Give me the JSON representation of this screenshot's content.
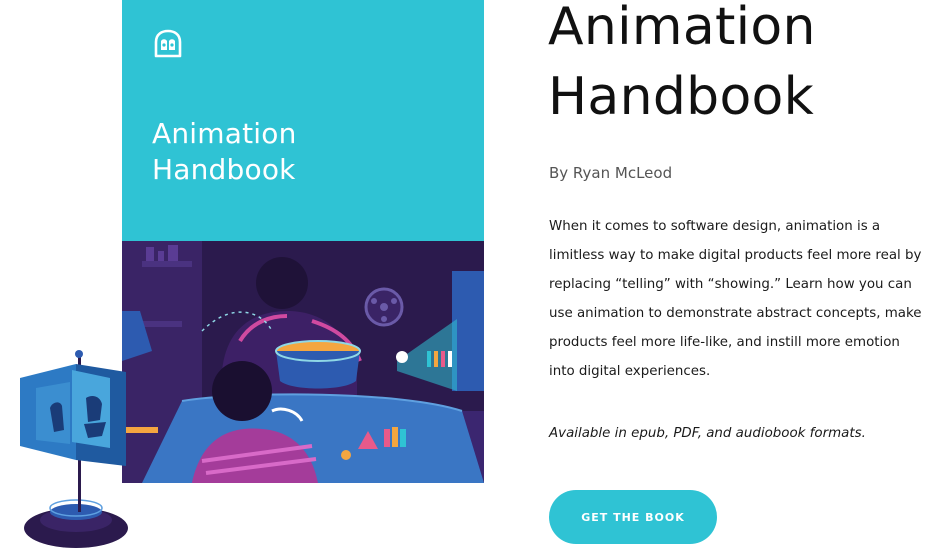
{
  "cover": {
    "title_line1": "Animation",
    "title_line2": "Handbook",
    "logo_icon": "owl-logo-icon",
    "top_color": "#2fc3d4",
    "illustration_bg": "#2b1a4d"
  },
  "book": {
    "title_line1": "Animation",
    "title_line2": "Handbook",
    "author": "By Ryan McLeod",
    "description": "When it comes to software design, animation is a limitless way to make digital products feel more real by replacing “telling” with “showing.” Learn how you can use animation to demonstrate abstract concepts, make products feel more life-like, and instill more emotion into digital experiences.",
    "availability": "Available in epub, PDF, and audiobook formats."
  },
  "cta": {
    "label": "GET THE BOOK",
    "color": "#2fc3d4"
  }
}
